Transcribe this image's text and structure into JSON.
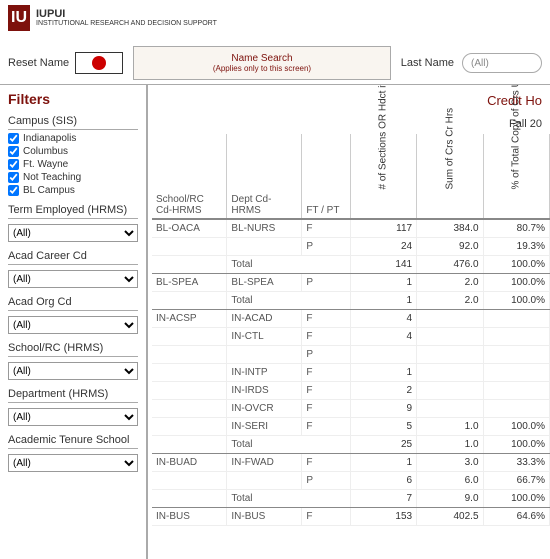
{
  "logo": {
    "name": "IUPUI",
    "sub": "INSTITUTIONAL RESEARCH AND DECISION SUPPORT"
  },
  "topbar": {
    "reset_label": "Reset Name",
    "search_title": "Name Search",
    "search_sub": "(Applies only to this screen)",
    "lastname_label": "Last Name",
    "lastname_value": "(All)"
  },
  "sidebar": {
    "title": "Filters",
    "campus": {
      "title": "Campus (SIS)",
      "items": [
        "Indianapolis",
        "Columbus",
        "Ft. Wayne",
        "Not Teaching",
        "BL Campus"
      ]
    },
    "dropdowns": [
      {
        "title": "Term Employed (HRMS)",
        "value": "(All)"
      },
      {
        "title": "Acad Career Cd",
        "value": "(All)"
      },
      {
        "title": "Acad Org Cd",
        "value": "(All)"
      },
      {
        "title": "School/RC (HRMS)",
        "value": "(All)"
      },
      {
        "title": "Department (HRMS)",
        "value": "(All)"
      },
      {
        "title": "Academic Tenure School",
        "value": "(All)"
      }
    ]
  },
  "report": {
    "title": "Credit Ho",
    "term": "Fall 20",
    "headers": {
      "school": "School/RC Cd-HRMS",
      "dept": "Dept Cd-HRMS",
      "ftpt": "FT / PT",
      "c1": "# of Sections OR Hdct if not teaching",
      "c2": "Sum of Crs Cr Hrs",
      "c3": "% of Total Copy of Crs Unit Nbr for.."
    },
    "rows": [
      {
        "school": "BL-OACA",
        "dept": "BL-NURS",
        "ft": "F",
        "v1": "117",
        "v2": "384.0",
        "v3": "80.7%"
      },
      {
        "school": "",
        "dept": "",
        "ft": "P",
        "v1": "24",
        "v2": "92.0",
        "v3": "19.3%"
      },
      {
        "school": "",
        "dept": "Total",
        "total": true,
        "v1": "141",
        "v2": "476.0",
        "v3": "100.0%"
      },
      {
        "school": "BL-SPEA",
        "dept": "BL-SPEA",
        "ft": "P",
        "v1": "1",
        "v2": "2.0",
        "v3": "100.0%"
      },
      {
        "school": "",
        "dept": "Total",
        "total": true,
        "v1": "1",
        "v2": "2.0",
        "v3": "100.0%"
      },
      {
        "school": "IN-ACSP",
        "dept": "IN-ACAD",
        "ft": "F",
        "v1": "4",
        "v2": "",
        "v3": ""
      },
      {
        "school": "",
        "dept": "IN-CTL",
        "ft": "F",
        "v1": "4",
        "v2": "",
        "v3": ""
      },
      {
        "school": "",
        "dept": "",
        "ft": "P",
        "v1": "",
        "v2": "",
        "v3": ""
      },
      {
        "school": "",
        "dept": "IN-INTP",
        "ft": "F",
        "v1": "1",
        "v2": "",
        "v3": ""
      },
      {
        "school": "",
        "dept": "IN-IRDS",
        "ft": "F",
        "v1": "2",
        "v2": "",
        "v3": ""
      },
      {
        "school": "",
        "dept": "IN-OVCR",
        "ft": "F",
        "v1": "9",
        "v2": "",
        "v3": ""
      },
      {
        "school": "",
        "dept": "IN-SERI",
        "ft": "F",
        "v1": "5",
        "v2": "1.0",
        "v3": "100.0%"
      },
      {
        "school": "",
        "dept": "Total",
        "total": true,
        "v1": "25",
        "v2": "1.0",
        "v3": "100.0%"
      },
      {
        "school": "IN-BUAD",
        "dept": "IN-FWAD",
        "ft": "F",
        "v1": "1",
        "v2": "3.0",
        "v3": "33.3%"
      },
      {
        "school": "",
        "dept": "",
        "ft": "P",
        "v1": "6",
        "v2": "6.0",
        "v3": "66.7%"
      },
      {
        "school": "",
        "dept": "Total",
        "total": true,
        "v1": "7",
        "v2": "9.0",
        "v3": "100.0%"
      },
      {
        "school": "IN-BUS",
        "dept": "IN-BUS",
        "ft": "F",
        "v1": "153",
        "v2": "402.5",
        "v3": "64.6%"
      }
    ]
  }
}
